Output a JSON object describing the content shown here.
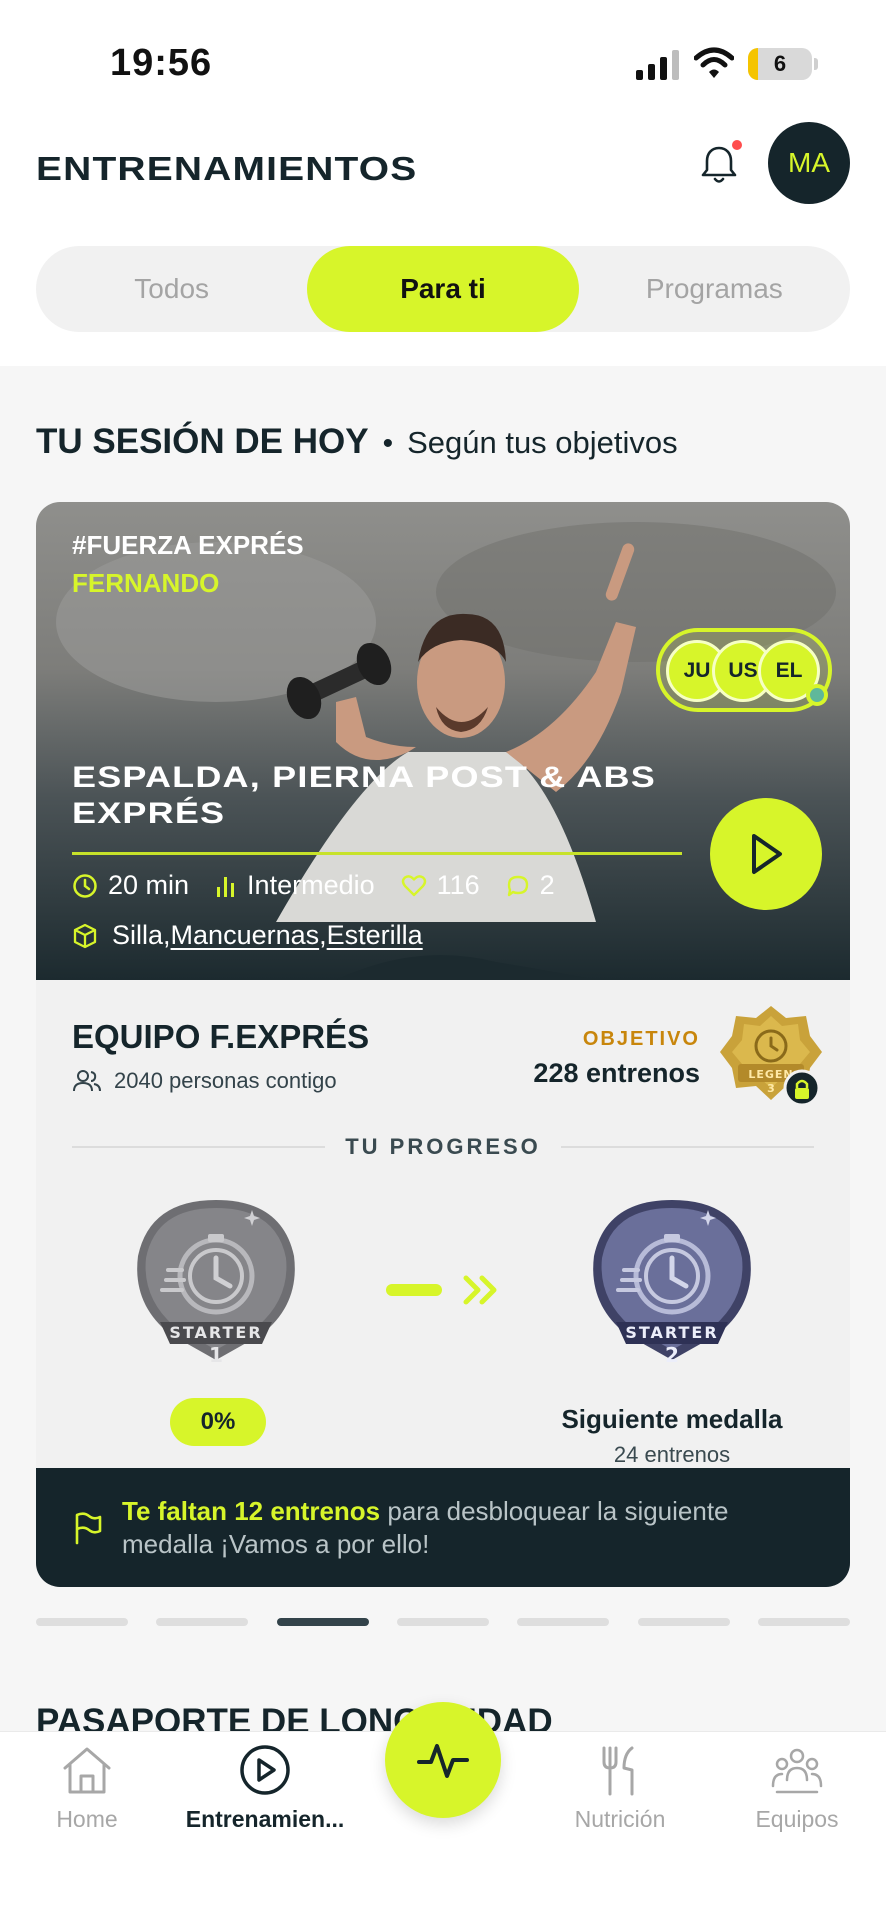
{
  "status_bar": {
    "time": "19:56",
    "battery": "6"
  },
  "header": {
    "title": "ENTRENAMIENTOS",
    "avatar_initials": "MA"
  },
  "tabs": [
    {
      "label": "Todos",
      "active": false
    },
    {
      "label": "Para ti",
      "active": true
    },
    {
      "label": "Programas",
      "active": false
    }
  ],
  "session": {
    "title": "TU SESIÓN DE HOY",
    "separator": "•",
    "subtitle": "Según tus objetivos",
    "card": {
      "tag": "#FUERZA EXPRÉS",
      "coach": "FERNANDO",
      "participants": [
        "JU",
        "US",
        "EL"
      ],
      "workout_title": "ESPALDA, PIERNA POST & ABS EXPRÉS",
      "duration": "20 min",
      "level": "Intermedio",
      "likes": "116",
      "comments": "2",
      "equipment": {
        "first": "Silla",
        "sep1": ", ",
        "second": "Mancuernas",
        "sep2": ", ",
        "third": "Esterilla"
      }
    },
    "team": {
      "name": "EQUIPO F.EXPRÉS",
      "people": "2040 personas contigo",
      "objective_label": "OBJETIVO",
      "objective_value": "228 entrenos",
      "legend_badge_text": "LEGEN",
      "legend_badge_num": "3"
    },
    "progress": {
      "heading": "TU PROGRESO",
      "current_medal": {
        "name": "STARTER",
        "level": "1"
      },
      "percent": "0%",
      "next_medal": {
        "name": "STARTER",
        "level": "2"
      },
      "next_title": "Siguiente medalla",
      "next_sub": "24 entrenos"
    },
    "banner": {
      "highlight": "Te faltan 12 entrenos",
      "rest": " para desbloquear la siguiente medalla ¡Vamos a por ello!"
    },
    "pager": {
      "count": 7,
      "active_index": 2
    }
  },
  "next_section_title": "PASAPORTE DE LONGEVIDAD",
  "bottom_nav": [
    {
      "label": "Home",
      "icon": "home-icon",
      "active": false
    },
    {
      "label": "Entrenamien...",
      "icon": "play-circle-icon",
      "active": true
    },
    {
      "label": "Nutrición",
      "icon": "fork-knife-icon",
      "active": false
    },
    {
      "label": "Equipos",
      "icon": "team-icon",
      "active": false
    }
  ],
  "colors": {
    "accent": "#d7f52a",
    "dark": "#15252b",
    "gold": "#c8860c"
  }
}
